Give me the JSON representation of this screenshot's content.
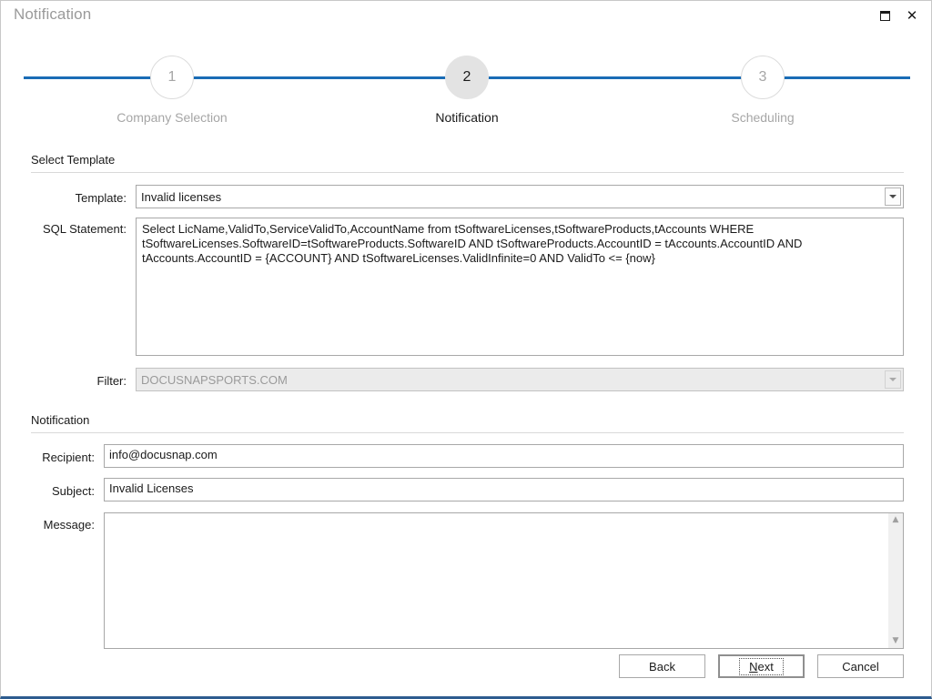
{
  "window": {
    "title": "Notification",
    "controls": [
      {
        "name": "restore-icon",
        "label": "❐"
      },
      {
        "name": "close-icon",
        "label": "✕"
      }
    ],
    "accent_color": "#2d5c8f"
  },
  "stepper": {
    "line_color": "#1a6cb5",
    "active_index": 2,
    "steps": [
      {
        "number": "1",
        "label": "Company Selection",
        "state": "inactive"
      },
      {
        "number": "2",
        "label": "Notification",
        "state": "active"
      },
      {
        "number": "3",
        "label": "Scheduling",
        "state": "inactive"
      }
    ]
  },
  "sections": {
    "select_template": {
      "heading": "Select Template",
      "template_label": "Template:",
      "template_value": "Invalid licenses",
      "sql_label": "SQL Statement:",
      "sql_value": "Select LicName,ValidTo,ServiceValidTo,AccountName from tSoftwareLicenses,tSoftwareProducts,tAccounts WHERE tSoftwareLicenses.SoftwareID=tSoftwareProducts.SoftwareID AND tSoftwareProducts.AccountID = tAccounts.AccountID AND tAccounts.AccountID = {ACCOUNT} AND tSoftwareLicenses.ValidInfinite=0 AND ValidTo <= {now}",
      "filter_label": "Filter:",
      "filter_value": "DOCUSNAPSPORTS.COM",
      "filter_disabled": true
    },
    "notification": {
      "heading": "Notification",
      "recipient_label": "Recipient:",
      "recipient_value": "info@docusnap.com",
      "subject_label": "Subject:",
      "subject_value": "Invalid Licenses",
      "message_label": "Message:",
      "message_value": ""
    }
  },
  "scrollbar": {
    "up_arrow": "▲",
    "down_arrow": "▼"
  },
  "footer": {
    "back_label": "Back",
    "next_accel": "N",
    "next_rest": "ext",
    "cancel_label": "Cancel"
  }
}
